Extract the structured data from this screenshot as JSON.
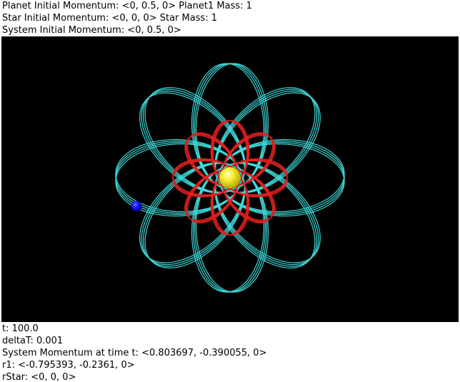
{
  "header": {
    "line1": "Planet Initial Momentum: <0, 0.5, 0> Planet1 Mass: 1",
    "line2": "Star Initial Momentum: <0, 0, 0> Star Mass: 1",
    "line3": "System Initial Momentum: <0, 0.5, 0>"
  },
  "footer": {
    "time": "t: 100.0",
    "delta_t": "deltaT: 0.001",
    "system_momentum": "System Momentum at time t: <0.803697, -0.390055, 0>",
    "r1": "r1: <-0.795393, -0.2361, 0>",
    "r_star": "rStar: <0, 0, 0>"
  },
  "scene": {
    "background_color": "#000000",
    "planet_orbit_color": "#3fd8d8",
    "star_orbit_color": "#e02020",
    "star_color": "#ffef1a",
    "planet_color": "#1010ff"
  }
}
